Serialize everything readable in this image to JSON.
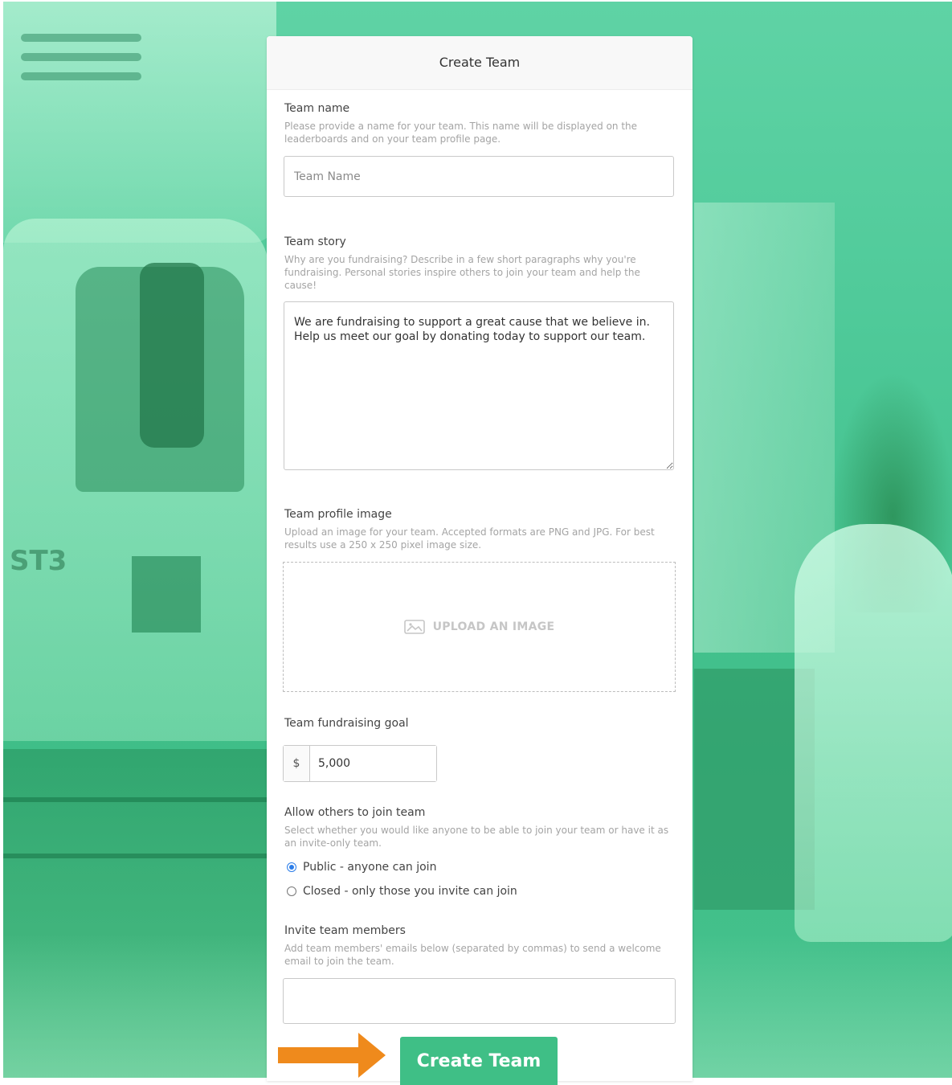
{
  "form": {
    "title": "Create Team",
    "team_name": {
      "label": "Team name",
      "help": "Please provide a name for your team. This name will be displayed on the leaderboards and on your team profile page.",
      "placeholder": "Team Name",
      "value": ""
    },
    "team_story": {
      "label": "Team story",
      "help": "Why are you fundraising? Describe in a few short paragraphs why you're fundraising. Personal stories inspire others to join your team and help the cause!",
      "value": "We are fundraising to support a great cause that we believe in. Help us meet our goal by donating today to support our team."
    },
    "profile_image": {
      "label": "Team profile image",
      "help": "Upload an image for your team. Accepted formats are PNG and JPG. For best results use a 250 x 250 pixel image size.",
      "upload_label": "UPLOAD AN IMAGE"
    },
    "goal": {
      "label": "Team fundraising goal",
      "currency": "$",
      "value": "5,000"
    },
    "join": {
      "label": "Allow others to join team",
      "help": "Select whether you would like anyone to be able to join your team or have it as an invite-only team.",
      "options": [
        {
          "label": "Public - anyone can join",
          "selected": true
        },
        {
          "label": "Closed - only those you invite can join",
          "selected": false
        }
      ]
    },
    "invite": {
      "label": "Invite team members",
      "help": "Add team members' emails below (separated by commas) to send a welcome email to join the team.",
      "value": ""
    },
    "submit_label": "Create Team"
  },
  "background": {
    "truck_marking": "ST3"
  },
  "colors": {
    "accent": "#3fbf86",
    "arrow": "#ef8a1c",
    "radio": "#2b7de9"
  }
}
